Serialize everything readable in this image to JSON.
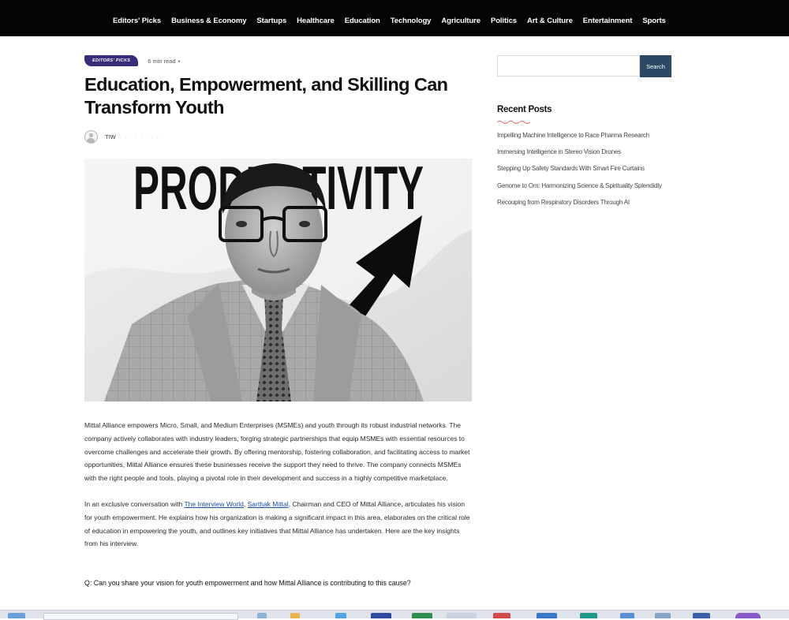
{
  "nav": {
    "items": [
      "Editors' Picks",
      "Business & Economy",
      "Startups",
      "Healthcare",
      "Education",
      "Technology",
      "Agriculture",
      "Politics",
      "Art & Culture",
      "Entertainment",
      "Sports"
    ]
  },
  "article": {
    "category_badge": "EDITORS' PICKS",
    "read_time": "6 min read",
    "read_sep": "•",
    "title": "Education, Empowerment, and Skilling Can Transform Youth",
    "author": "TIW",
    "author_meta": "· · · · · · · · ·",
    "image_text": "PRODUCTIVITY",
    "paragraphs": {
      "p1": "Mittal Alliance empowers Micro, Small, and Medium Enterprises (MSMEs) and youth through its robust industrial networks. The company actively collaborates with industry leaders, forging strategic partnerships that equip MSMEs with essential resources to overcome challenges and accelerate their growth. By offering mentorship, fostering collaboration, and facilitating access to market opportunities, Mittal Alliance ensures these businesses receive the support they need to thrive. The company connects MSMEs with the right people and tools, playing a pivotal role in their development and success in a highly competitive marketplace.",
      "p2_before": "In an exclusive conversation with ",
      "p2_link1": "The Interview World",
      "p2_mid": ", ",
      "p2_link2": "Sarthak Mittal",
      "p2_after": ", Chairman and CEO of Mittal Alliance, articulates his vision for youth empowerment. He explains how his organization is making a significant impact in this area, elaborates on the critical role of education in empowering the youth, and outlines key initiatives that Mittal Alliance has undertaken. Here are the key insights from his interview."
    },
    "question": "Q: Can you share your vision for youth empowerment and how Mittal Alliance is contributing to this cause?"
  },
  "sidebar": {
    "search_placeholder": "",
    "search_button": "Search",
    "recent_title": "Recent Posts",
    "recent_posts": [
      "Impelling Machine Intelligence to Race Pharma Research",
      "Immersing Intelligence in Stereo Vision Drones",
      "Stepping Up Safety Standards With Smart Fire Curtains",
      "Genome to Om: Harmonizing Science & Spirituality Splendidly",
      "Recouping from Respiratory Disorders Through AI"
    ]
  },
  "colors": {
    "nav_bg": "#050505",
    "badge_bg": "#3a2a7a",
    "search_button_bg": "#2b4964",
    "link": "#1a4fa6",
    "accent_wave": "#e36a6a"
  }
}
